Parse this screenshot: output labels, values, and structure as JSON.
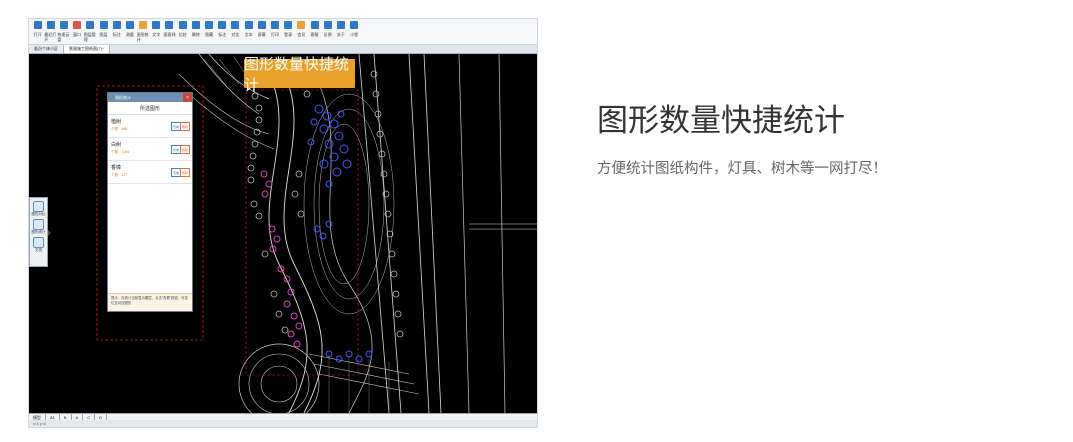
{
  "screenshot": {
    "toolbar": {
      "buttons": [
        {
          "label": "打开",
          "icon": "open-folder-icon"
        },
        {
          "label": "最近打开",
          "icon": "clock-icon"
        },
        {
          "label": "快速云盘",
          "icon": "cloud-icon"
        },
        {
          "label": "窗口",
          "icon": "window-close-icon"
        },
        {
          "label": "图层管理",
          "icon": "layers-icon"
        },
        {
          "label": "图层",
          "icon": "layer-icon"
        },
        {
          "label": "标注",
          "icon": "annotation-icon"
        },
        {
          "label": "测量",
          "icon": "ruler-icon"
        },
        {
          "label": "图形统计",
          "icon": "stats-icon"
        },
        {
          "label": "文字",
          "icon": "text-icon"
        },
        {
          "label": "画直线",
          "icon": "line-icon"
        },
        {
          "label": "比较",
          "icon": "compare-icon"
        },
        {
          "label": "删除",
          "icon": "eraser-icon"
        },
        {
          "label": "隐藏",
          "icon": "hide-icon"
        },
        {
          "label": "标注",
          "icon": "pin-icon"
        },
        {
          "label": "对比",
          "icon": "diff-icon"
        },
        {
          "label": "文本",
          "icon": "doc-icon"
        },
        {
          "label": "屏幕",
          "icon": "screen-icon"
        },
        {
          "label": "打印",
          "icon": "print-icon"
        },
        {
          "label": "登录",
          "icon": "user-icon"
        },
        {
          "label": "会员",
          "icon": "vip-icon"
        },
        {
          "label": "客服",
          "icon": "headset-icon"
        },
        {
          "label": "反馈",
          "icon": "feedback-icon"
        },
        {
          "label": "关于",
          "icon": "info-icon"
        },
        {
          "label": "小程",
          "icon": "k-logo-icon"
        }
      ]
    },
    "file_tabs": [
      "临汾个体小区",
      "景观施工图纸图(T)*"
    ],
    "dialog": {
      "title": "图形统计",
      "header": "所选图形",
      "items": [
        {
          "name": "植树",
          "count": "个数：385",
          "btn1": "查看",
          "btn2": "删除"
        },
        {
          "name": "白树",
          "count": "个数：1056",
          "btn1": "查看",
          "btn2": "删除"
        },
        {
          "name": "香樟",
          "count": "个数：127",
          "btn1": "查看",
          "btn2": "删除"
        }
      ],
      "footer": "提示：仅统计当前显示图层，点击\"查看\"按钮，可定位至对应图形"
    },
    "left_panel": [
      {
        "label": "图形对比",
        "icon": "compare-panel-icon"
      },
      {
        "label": "图形统计",
        "icon": "stats-panel-icon"
      },
      {
        "label": "文档",
        "icon": "doc-panel-icon"
      }
    ],
    "bottom_tabs": [
      "模型",
      "A1",
      "B",
      "A",
      "C",
      "D"
    ],
    "status": "x=0  y=0",
    "badge": "图形数量快捷统计"
  },
  "feature": {
    "title": "图形数量快捷统计",
    "description": "方便统计图纸构件，灯具、树木等一网打尽！"
  },
  "colors": {
    "badge": "#e8a028",
    "selection_dash": "#d02020",
    "trees_blue": "#3a5cff",
    "trees_pink": "#e040c0",
    "dialog_count": "#e07b1e"
  }
}
